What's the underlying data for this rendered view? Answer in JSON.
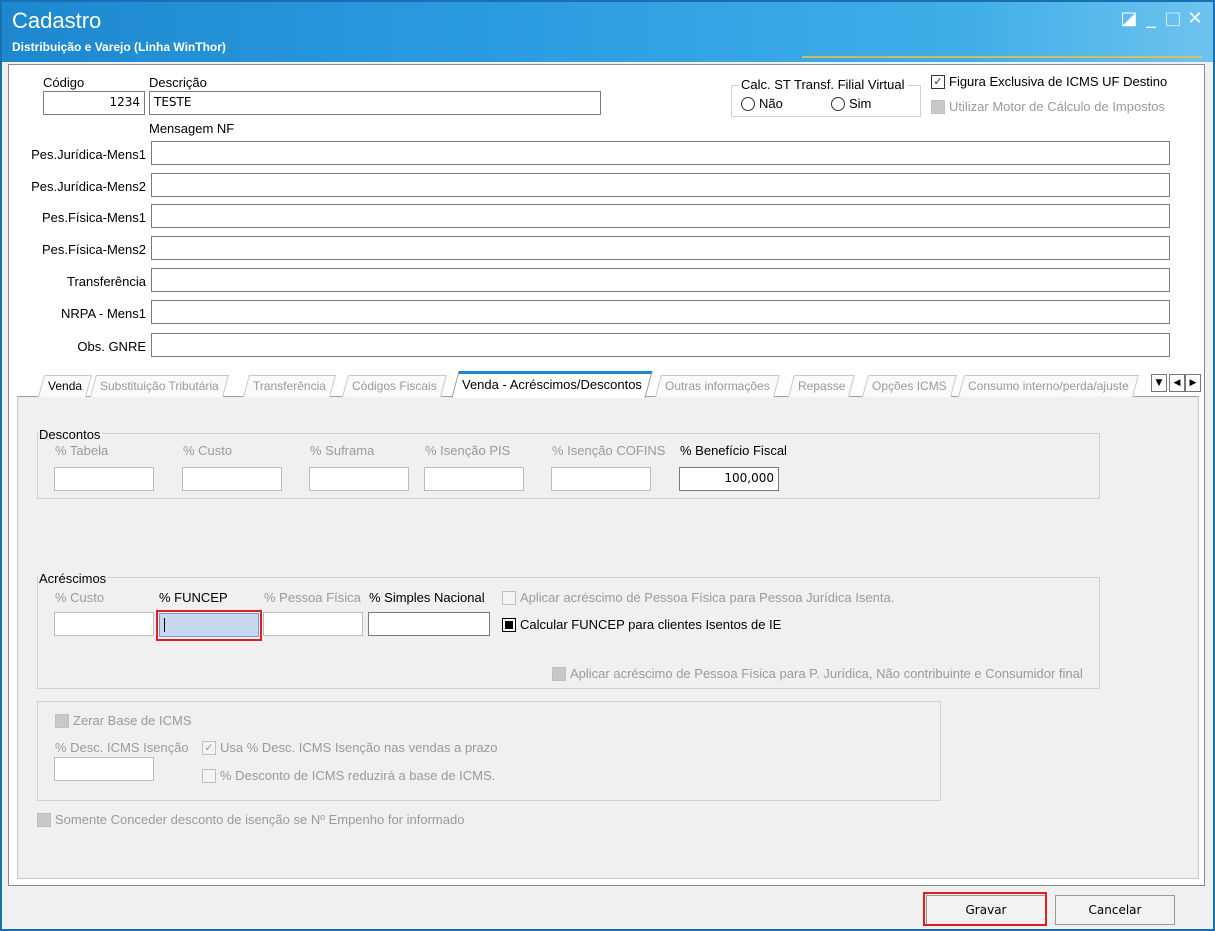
{
  "window": {
    "title": "Cadastro",
    "subtitle": "Distribuição e Varejo (Linha WinThor)",
    "buttons": {
      "restore": "◪",
      "minimize": "_",
      "maximize": "□",
      "close": "✕"
    }
  },
  "header": {
    "codigo_label": "Código",
    "codigo_value": "1234",
    "descricao_label": "Descrição",
    "descricao_value": "TESTE",
    "mensagem_nf_label": "Mensagem NF",
    "calc_st_group": "Calc. ST Transf. Filial Virtual",
    "radio_nao": "Não",
    "radio_sim": "Sim",
    "figura_exclusiva": "Figura Exclusiva de ICMS UF Destino",
    "utilizar_motor": "Utilizar Motor de Cálculo de Impostos"
  },
  "messages": [
    {
      "label": "Pes.Jurídica-Mens1",
      "value": ""
    },
    {
      "label": "Pes.Jurídica-Mens2",
      "value": ""
    },
    {
      "label": "Pes.Física-Mens1",
      "value": ""
    },
    {
      "label": "Pes.Física-Mens2",
      "value": ""
    },
    {
      "label": "Transferência",
      "value": ""
    },
    {
      "label": "NRPA - Mens1",
      "value": ""
    },
    {
      "label": "Obs. GNRE",
      "value": ""
    }
  ],
  "tabs": [
    "Venda",
    "Substituição Tributária",
    "Transferência",
    "Códigos Fiscais",
    "Venda - Acréscimos/Descontos",
    "Outras informações",
    "Repasse",
    "Opções ICMS",
    "Consumo interno/perda/ajuste"
  ],
  "active_tab": "Venda - Acréscimos/Descontos",
  "descontos": {
    "group_label": "Descontos",
    "fields": [
      {
        "label": "% Tabela",
        "value": ""
      },
      {
        "label": "% Custo",
        "value": ""
      },
      {
        "label": "% Suframa",
        "value": ""
      },
      {
        "label": "% Isenção PIS",
        "value": ""
      },
      {
        "label": "% Isenção COFINS",
        "value": ""
      },
      {
        "label": "% Benefício Fiscal",
        "value": "100,000"
      }
    ]
  },
  "acrescimos": {
    "group_label": "Acréscimos",
    "fields": [
      {
        "label": "% Custo",
        "value": ""
      },
      {
        "label": "% FUNCEP",
        "value": ""
      },
      {
        "label": "% Pessoa Física",
        "value": ""
      },
      {
        "label": "% Simples Nacional",
        "value": ""
      }
    ],
    "aplicar_pf_pj_isenta": "Aplicar acréscimo de Pessoa Física para Pessoa Jurídica Isenta.",
    "calcular_funcep": "Calcular FUNCEP para clientes Isentos de IE",
    "aplicar_pf_nao_contribuinte": "Aplicar acréscimo de Pessoa Física para P. Jurídica, Não contribuinte e Consumidor final"
  },
  "icms": {
    "zerar_base": "Zerar Base de ICMS",
    "desc_isencao_label": "% Desc. ICMS Isenção",
    "desc_isencao_value": "",
    "usa_desc_prazo": "Usa % Desc. ICMS Isenção nas vendas a prazo",
    "desconto_reduzira": "% Desconto de ICMS reduzirá a base de ICMS."
  },
  "somente_conceder": "Somente Conceder desconto de isenção se Nº Empenho for informado",
  "footer": {
    "gravar": "Gravar",
    "cancelar": "Cancelar"
  },
  "colors": {
    "titlebar": "#1e88cf",
    "highlight": "#e02020",
    "tab_accent": "#1e88cf"
  }
}
